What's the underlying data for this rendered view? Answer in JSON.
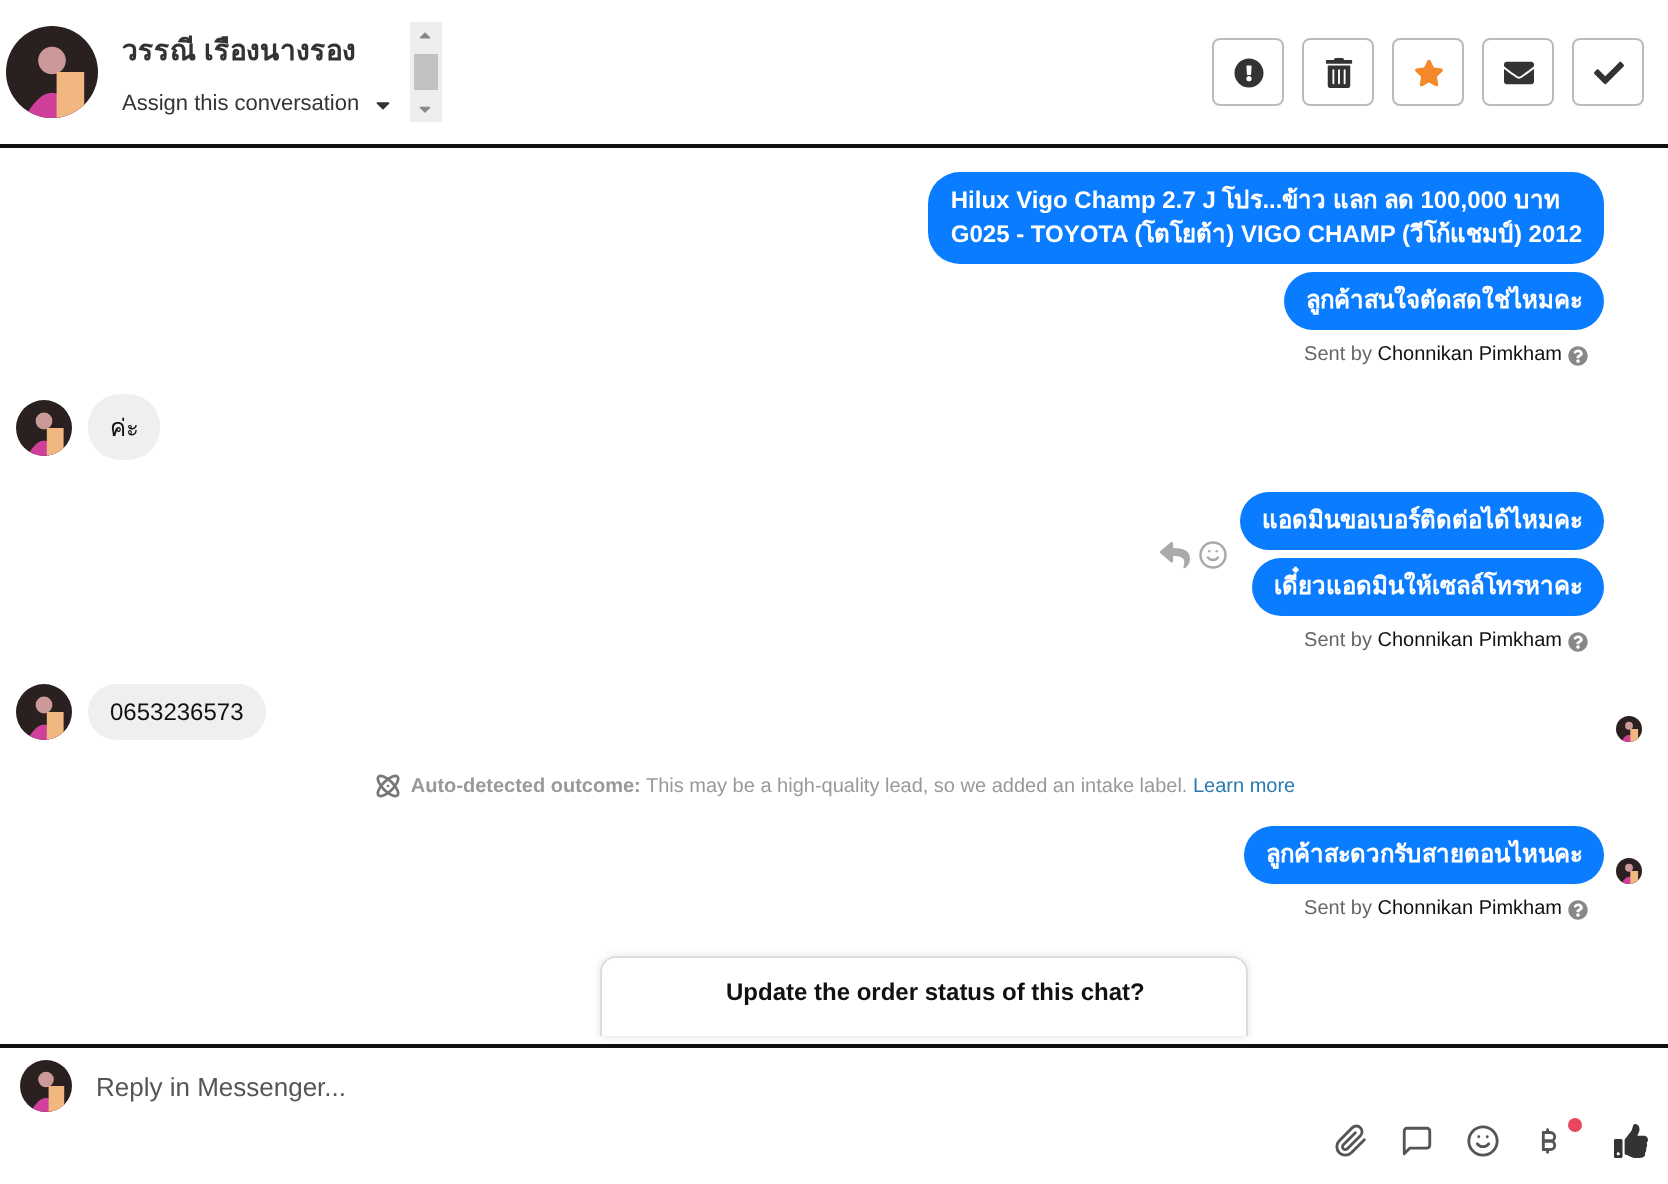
{
  "header": {
    "name": "วรรณี เรืองนางรอง",
    "assign_label": "Assign this conversation"
  },
  "actions": [
    {
      "kind": "alert",
      "on": false
    },
    {
      "kind": "trash",
      "on": false
    },
    {
      "kind": "star",
      "on": true
    },
    {
      "kind": "mail",
      "on": false
    },
    {
      "kind": "check",
      "on": false
    }
  ],
  "messages": [
    {
      "kind": "outgoing",
      "bubbles": [
        "Hilux Vigo Champ 2.7 J โปร...ข้าว แลก ลด 100,000 บาท\nG025 - TOYOTA (โตโยต้า) VIGO CHAMP (วีโก้แชมป์) 2012",
        "ลูกค้าสนใจตัดสดใช่ไหมคะ"
      ],
      "reactions": false,
      "seen": false
    },
    {
      "kind": "sent_by",
      "prefix": "Sent by",
      "name": "Chonnikan Pimkham"
    },
    {
      "kind": "incoming",
      "text": "ค่ะ",
      "seen": false
    },
    {
      "kind": "outgoing",
      "bubbles": [
        "แอดมินขอเบอร์ติดต่อได้ไหมคะ",
        "เดี๋ยวแอดมินให้เซลล์โทรหาคะ"
      ],
      "reactions": true,
      "seen": false
    },
    {
      "kind": "sent_by",
      "prefix": "Sent by",
      "name": "Chonnikan Pimkham"
    },
    {
      "kind": "incoming",
      "text": "0653236573",
      "seen": true
    },
    {
      "kind": "notice",
      "label": "Auto-detected outcome:",
      "text": "This may be a high-quality lead, so we added an intake label.",
      "link": "Learn more"
    },
    {
      "kind": "outgoing",
      "bubbles": [
        "ลูกค้าสะดวกรับสายตอนไหนคะ"
      ],
      "reactions": false,
      "seen": true
    },
    {
      "kind": "sent_by",
      "prefix": "Sent by",
      "name": "Chonnikan Pimkham"
    },
    {
      "kind": "card",
      "title": "Update the order status of this chat?"
    }
  ],
  "composer": {
    "placeholder": "Reply in Messenger...",
    "currency_badge": true
  }
}
